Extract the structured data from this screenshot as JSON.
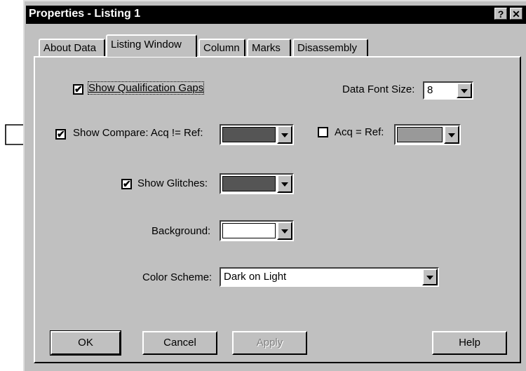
{
  "window": {
    "title": "Properties - Listing 1",
    "help_button": "?",
    "close_button": "✕"
  },
  "tabs": [
    {
      "label": "About Data"
    },
    {
      "label": "Listing Window",
      "active": true
    },
    {
      "label": "Column"
    },
    {
      "label": "Marks"
    },
    {
      "label": "Disassembly"
    }
  ],
  "options": {
    "show_qualification_gaps": {
      "label": "Show Qualification Gaps",
      "checked": true
    },
    "data_font_size": {
      "label": "Data Font Size:",
      "value": "8"
    },
    "show_compare": {
      "label": "Show Compare: Acq != Ref:",
      "checked": true,
      "color": "#555555"
    },
    "acq_eq_ref": {
      "label": "Acq = Ref:",
      "checked": false,
      "color": "#999999"
    },
    "show_glitches": {
      "label": "Show Glitches:",
      "checked": true,
      "color": "#555555"
    },
    "background": {
      "label": "Background:",
      "color": "#ffffff"
    },
    "color_scheme": {
      "label": "Color Scheme:",
      "value": "Dark on Light"
    }
  },
  "buttons": {
    "ok": "OK",
    "cancel": "Cancel",
    "apply": "Apply",
    "help": "Help"
  },
  "check_glyph": "✔",
  "pointer_icon": "arrow-right-outline"
}
